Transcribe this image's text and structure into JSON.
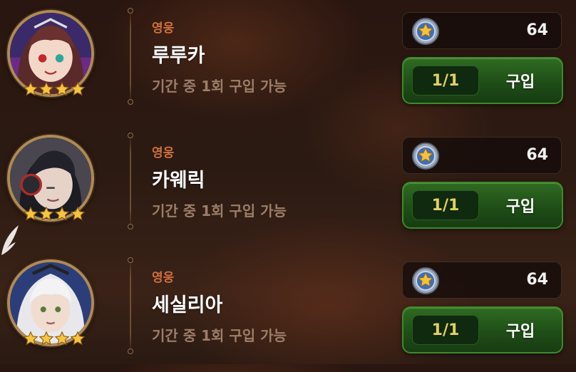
{
  "shop_items": [
    {
      "type_label": "영웅",
      "name": "루루카",
      "limit_text": "기간 중 1회 구입 가능",
      "price": "64",
      "purchase_count": "1/1",
      "buy_label": "구입",
      "stars": 4,
      "portrait_icon": "hero-ruruka-portrait",
      "hair_color": "#5a2a2a",
      "bg_color": "#3a2a6a"
    },
    {
      "type_label": "영웅",
      "name": "카웨릭",
      "limit_text": "기간 중 1회 구입 가능",
      "price": "64",
      "purchase_count": "1/1",
      "buy_label": "구입",
      "stars": 4,
      "portrait_icon": "hero-kawerik-portrait",
      "hair_color": "#1c1c22",
      "bg_color": "#4a4650"
    },
    {
      "type_label": "영웅",
      "name": "세실리아",
      "limit_text": "기간 중 1회 구입 가능",
      "price": "64",
      "purchase_count": "1/1",
      "buy_label": "구입",
      "stars": 4,
      "portrait_icon": "hero-cecilia-portrait",
      "hair_color": "#e8e8ec",
      "bg_color": "#2c3e7a"
    }
  ],
  "currency_icon": "star-coin-icon",
  "colors": {
    "accent_orange": "#d1703e",
    "button_green": "#2f6b22",
    "count_yellow": "#e4d060",
    "star_gold": "#f5c542"
  }
}
